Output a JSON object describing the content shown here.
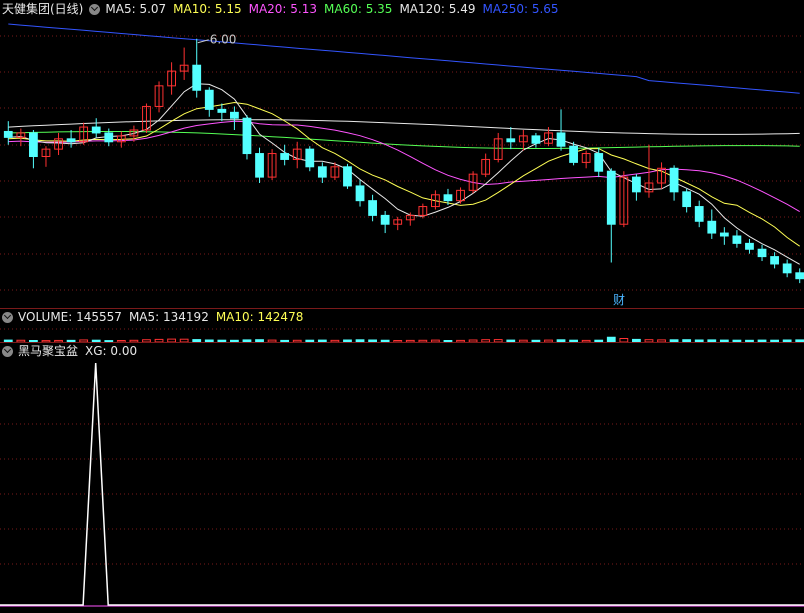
{
  "price": {
    "stock_name": "天健集团(日线)",
    "ma": [
      {
        "label": "MA5:",
        "value": "5.07",
        "color": "#e8e8e8"
      },
      {
        "label": "MA10:",
        "value": "5.15",
        "color": "#ffff55"
      },
      {
        "label": "MA20:",
        "value": "5.13",
        "color": "#ff55ff"
      },
      {
        "label": "MA60:",
        "value": "5.35",
        "color": "#55ff55"
      },
      {
        "label": "MA120:",
        "value": "5.49",
        "color": "#e8e8e8"
      },
      {
        "label": "MA250:",
        "value": "5.65",
        "color": "#3355ff"
      }
    ],
    "high_marker": "6.00",
    "event_marker": "财"
  },
  "volume": {
    "label": "VOLUME:",
    "value": "145557",
    "ma5_label": "MA5:",
    "ma5_value": "134192",
    "ma10_label": "MA10:",
    "ma10_value": "142478"
  },
  "indicator": {
    "name": "黑马聚宝盆",
    "xg_label": "XG:",
    "xg_value": "0.00"
  },
  "colors": {
    "up": "#ff3232",
    "down": "#54ffff",
    "grid": "#7a1a1a",
    "ma5": "#e8e8e8",
    "ma10": "#ffff55",
    "ma20": "#ff55ff",
    "ma60": "#55ff55",
    "ma120": "#e8e8e8",
    "ma250": "#3355ff"
  },
  "chart_data": {
    "type": "candlestick",
    "candles": [
      [
        5.37,
        5.44,
        5.28,
        5.33
      ],
      [
        5.33,
        5.39,
        5.27,
        5.36
      ],
      [
        5.36,
        5.38,
        5.12,
        5.2
      ],
      [
        5.2,
        5.27,
        5.13,
        5.25
      ],
      [
        5.25,
        5.36,
        5.21,
        5.32
      ],
      [
        5.32,
        5.38,
        5.26,
        5.3
      ],
      [
        5.3,
        5.43,
        5.28,
        5.4
      ],
      [
        5.4,
        5.46,
        5.33,
        5.36
      ],
      [
        5.36,
        5.39,
        5.27,
        5.3
      ],
      [
        5.3,
        5.37,
        5.26,
        5.34
      ],
      [
        5.34,
        5.41,
        5.3,
        5.38
      ],
      [
        5.38,
        5.56,
        5.36,
        5.54
      ],
      [
        5.54,
        5.71,
        5.5,
        5.68
      ],
      [
        5.68,
        5.84,
        5.62,
        5.78
      ],
      [
        5.78,
        5.94,
        5.72,
        5.82
      ],
      [
        5.82,
        6.0,
        5.6,
        5.65
      ],
      [
        5.65,
        5.67,
        5.47,
        5.52
      ],
      [
        5.52,
        5.56,
        5.44,
        5.5
      ],
      [
        5.5,
        5.54,
        5.38,
        5.46
      ],
      [
        5.46,
        5.48,
        5.18,
        5.22
      ],
      [
        5.22,
        5.26,
        5.02,
        5.06
      ],
      [
        5.06,
        5.25,
        5.04,
        5.22
      ],
      [
        5.22,
        5.28,
        5.14,
        5.18
      ],
      [
        5.18,
        5.3,
        5.12,
        5.25
      ],
      [
        5.25,
        5.27,
        5.1,
        5.13
      ],
      [
        5.13,
        5.16,
        5.02,
        5.06
      ],
      [
        5.06,
        5.16,
        5.04,
        5.13
      ],
      [
        5.13,
        5.15,
        4.98,
        5.0
      ],
      [
        5.0,
        5.04,
        4.86,
        4.9
      ],
      [
        4.9,
        4.94,
        4.76,
        4.8
      ],
      [
        4.8,
        4.83,
        4.68,
        4.74
      ],
      [
        4.74,
        4.79,
        4.7,
        4.77
      ],
      [
        4.77,
        4.82,
        4.73,
        4.8
      ],
      [
        4.8,
        4.88,
        4.78,
        4.86
      ],
      [
        4.86,
        4.97,
        4.84,
        4.94
      ],
      [
        4.94,
        4.98,
        4.87,
        4.9
      ],
      [
        4.9,
        4.99,
        4.88,
        4.97
      ],
      [
        4.97,
        5.1,
        4.95,
        5.08
      ],
      [
        5.08,
        5.22,
        5.06,
        5.18
      ],
      [
        5.18,
        5.36,
        5.16,
        5.32
      ],
      [
        5.32,
        5.4,
        5.25,
        5.3
      ],
      [
        5.3,
        5.38,
        5.24,
        5.34
      ],
      [
        5.34,
        5.36,
        5.26,
        5.29
      ],
      [
        5.29,
        5.4,
        5.27,
        5.36
      ],
      [
        5.36,
        5.52,
        5.24,
        5.27
      ],
      [
        5.27,
        5.3,
        5.14,
        5.16
      ],
      [
        5.16,
        5.24,
        5.12,
        5.22
      ],
      [
        5.22,
        5.26,
        5.06,
        5.1
      ],
      [
        5.1,
        5.12,
        4.48,
        4.74
      ],
      [
        4.74,
        5.1,
        4.72,
        5.06
      ],
      [
        5.06,
        5.08,
        4.9,
        4.96
      ],
      [
        4.96,
        5.28,
        4.92,
        5.02
      ],
      [
        5.02,
        5.16,
        4.98,
        5.12
      ],
      [
        5.12,
        5.14,
        4.9,
        4.96
      ],
      [
        4.96,
        4.98,
        4.82,
        4.86
      ],
      [
        4.86,
        4.9,
        4.72,
        4.76
      ],
      [
        4.76,
        4.84,
        4.64,
        4.68
      ],
      [
        4.68,
        4.72,
        4.6,
        4.66
      ],
      [
        4.66,
        4.7,
        4.58,
        4.61
      ],
      [
        4.61,
        4.64,
        4.54,
        4.57
      ],
      [
        4.57,
        4.6,
        4.49,
        4.52
      ],
      [
        4.52,
        4.55,
        4.44,
        4.47
      ],
      [
        4.47,
        4.5,
        4.38,
        4.41
      ],
      [
        4.41,
        4.44,
        4.34,
        4.37
      ]
    ],
    "volumes": [
      38,
      35,
      30,
      28,
      31,
      33,
      41,
      36,
      28,
      30,
      34,
      45,
      52,
      58,
      56,
      48,
      40,
      36,
      34,
      42,
      46,
      38,
      32,
      34,
      36,
      38,
      33,
      40,
      44,
      40,
      35,
      30,
      32,
      34,
      38,
      30,
      32,
      40,
      46,
      48,
      38,
      36,
      34,
      38,
      44,
      36,
      32,
      36,
      95,
      70,
      52,
      46,
      42,
      44,
      46,
      40,
      42,
      38,
      36,
      34,
      38,
      36,
      40,
      42
    ],
    "xg_signal": [
      0,
      0,
      0,
      0,
      0,
      0,
      1,
      0,
      0,
      0,
      0,
      0,
      0,
      0,
      0,
      0,
      0,
      0,
      0,
      0,
      0,
      0,
      0,
      0,
      0,
      0,
      0,
      0,
      0,
      0,
      0,
      0,
      0,
      0,
      0,
      0,
      0,
      0,
      0,
      0,
      0,
      0,
      0,
      0,
      0,
      0,
      0,
      0,
      0,
      0,
      0,
      0,
      0,
      0,
      0,
      0,
      0,
      0,
      0,
      0,
      0,
      0,
      0,
      0
    ]
  }
}
